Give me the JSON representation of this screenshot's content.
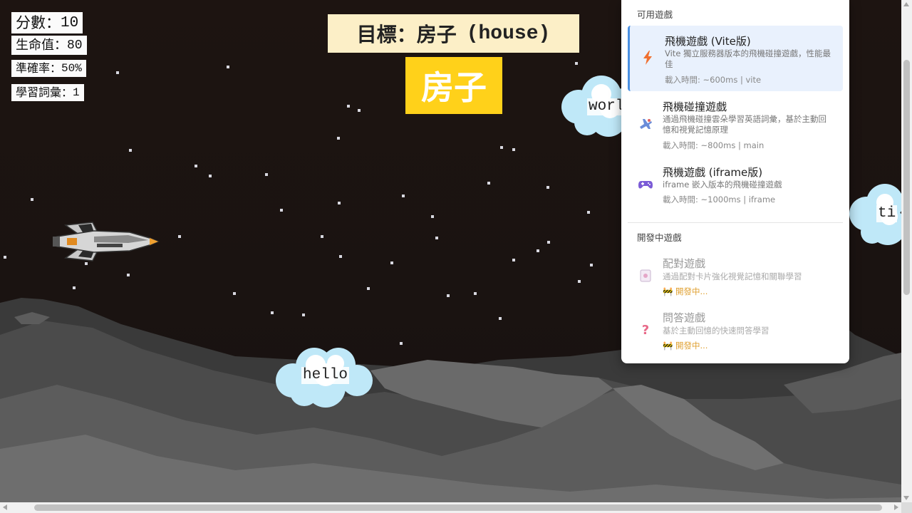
{
  "hud": {
    "score_label": "分數：",
    "score_value": "10",
    "life_label": "生命值：",
    "life_value": "80",
    "accuracy_label": "準確率：",
    "accuracy_value": "50%",
    "vocab_label": "學習詞彙：",
    "vocab_value": "1"
  },
  "target": {
    "label": "目標：",
    "word_zh": "房子",
    "word_en": "(house)",
    "display_word": "房子"
  },
  "clouds": [
    {
      "word": "hello"
    },
    {
      "word": "worl"
    },
    {
      "word": "ti"
    }
  ],
  "menu": {
    "available_title": "可用遊戲",
    "dev_title": "開發中遊戲",
    "available": [
      {
        "icon": "lightning-icon",
        "title": "飛機遊戲 (Vite版)",
        "desc": "Vite 獨立服務器版本的飛機碰撞遊戲，性能最佳",
        "meta": "載入時間: ~600ms | vite",
        "active": true
      },
      {
        "icon": "airplane-icon",
        "title": "飛機碰撞遊戲",
        "desc": "通過飛機碰撞雲朵學習英語詞彙，基於主動回憶和視覺記憶原理",
        "meta": "載入時間: ~800ms | main",
        "active": false
      },
      {
        "icon": "gamepad-icon",
        "title": "飛機遊戲 (iframe版)",
        "desc": "iframe 嵌入版本的飛機碰撞遊戲",
        "meta": "載入時間: ~1000ms | iframe",
        "active": false
      }
    ],
    "developing": [
      {
        "icon": "card-icon",
        "title": "配對遊戲",
        "desc": "通過配對卡片強化視覺記憶和關聯學習",
        "meta": "🚧 開發中..."
      },
      {
        "icon": "question-icon",
        "title": "問答遊戲",
        "desc": "基於主動回憶的快速問答學習",
        "meta": "🚧 開發中..."
      }
    ]
  },
  "colors": {
    "sky": "#1b1412",
    "target_word_bg": "#ffd11a",
    "target_banner_bg": "#fcefc7",
    "menu_active_bg": "#e9f1fd",
    "menu_active_border": "#4a90e2",
    "dev_meta": "#e0a030"
  }
}
